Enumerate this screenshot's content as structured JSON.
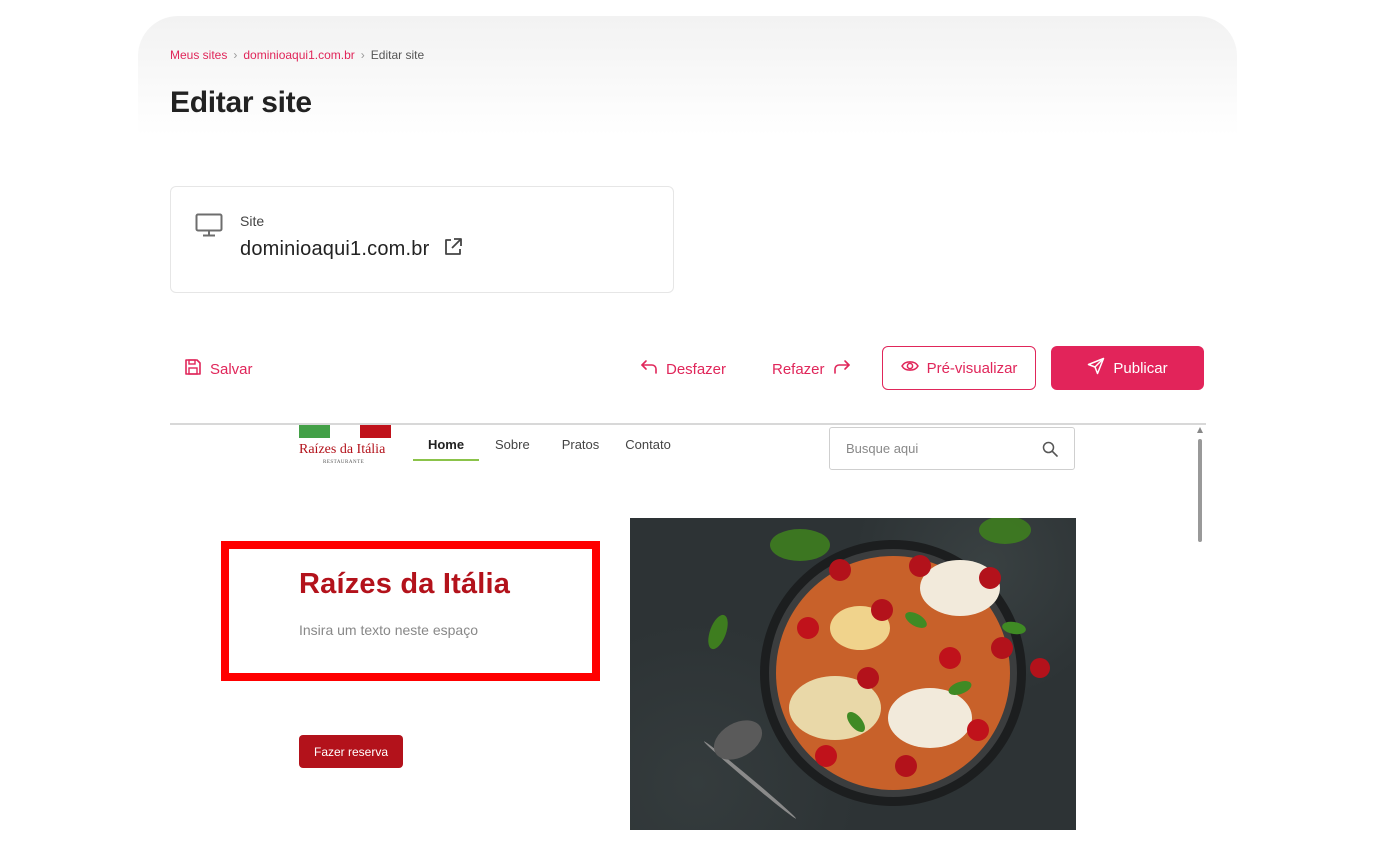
{
  "breadcrumb": {
    "items": [
      "Meus sites",
      "dominioaqui1.com.br",
      "Editar site"
    ],
    "separator": "›"
  },
  "page": {
    "title": "Editar site"
  },
  "site_card": {
    "label": "Site",
    "domain": "dominioaqui1.com.br",
    "icon": "monitor-icon",
    "link_icon": "external-link-icon"
  },
  "toolbar": {
    "save_label": "Salvar",
    "undo_label": "Desfazer",
    "redo_label": "Refazer",
    "preview_label": "Pré-visualizar",
    "publish_label": "Publicar"
  },
  "colors": {
    "accent": "#e0265a",
    "brand_red": "#b3121b",
    "flag_green": "#43a047",
    "selection_frame": "#ff0000"
  },
  "preview_site": {
    "logo": {
      "name": "Raízes da Itália",
      "subtitle": "RESTAURANTE"
    },
    "nav": {
      "items": [
        "Home",
        "Sobre",
        "Pratos",
        "Contato"
      ],
      "active": "Home"
    },
    "search": {
      "placeholder": "Busque aqui",
      "value": ""
    },
    "hero": {
      "title": "Raízes da Itália",
      "subtitle": "Insira um texto neste espaço",
      "cta_label": "Fazer reserva"
    },
    "image": "pasta-pan-photo"
  }
}
